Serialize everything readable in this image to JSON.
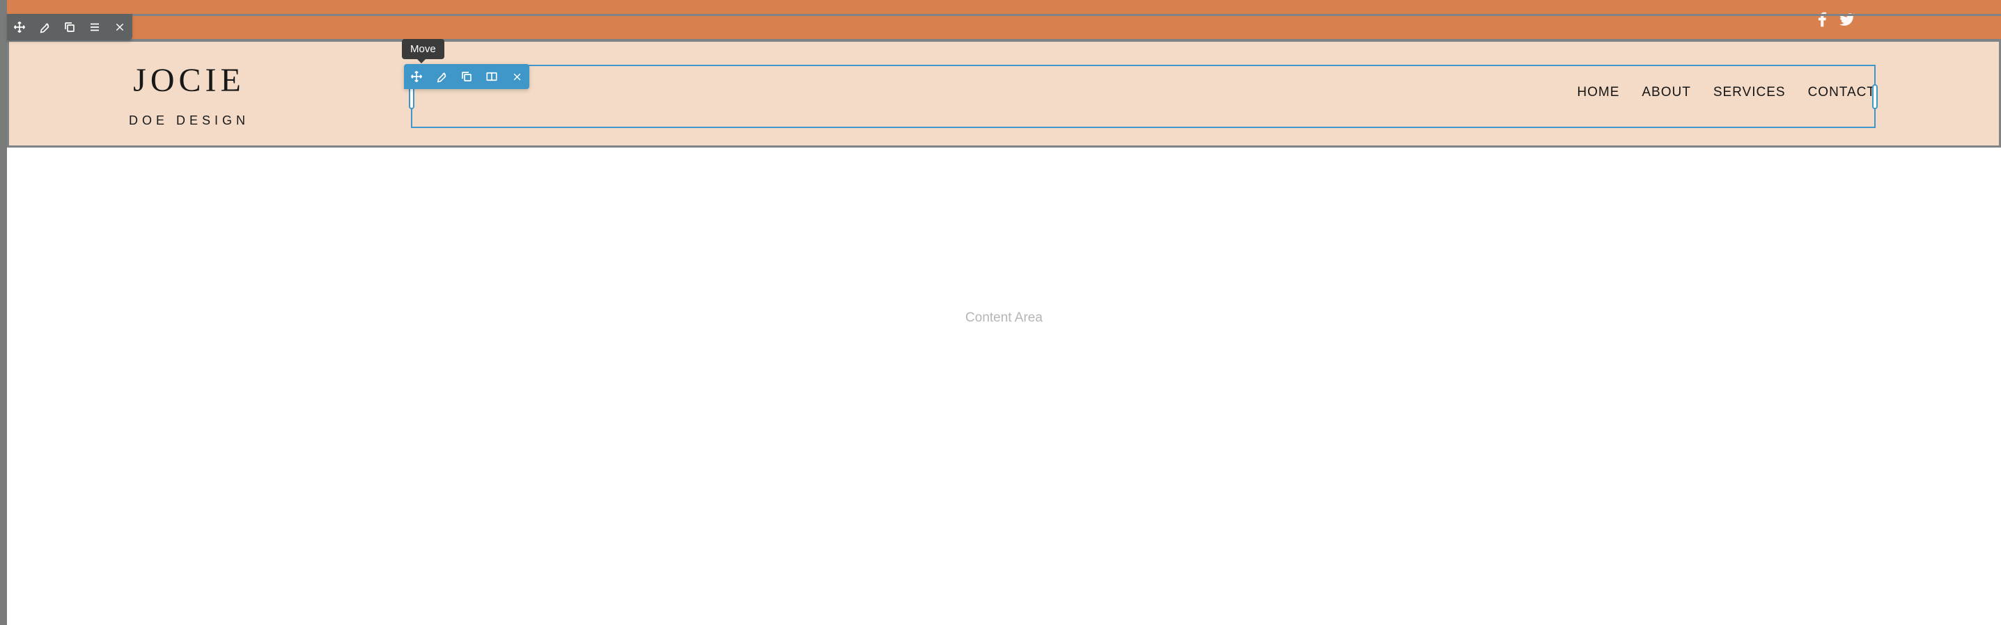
{
  "tooltip": {
    "move": "Move"
  },
  "header": {
    "logo_title": "JOCIE",
    "logo_subtitle": "DOE DESIGN"
  },
  "nav": {
    "items": [
      {
        "label": "HOME"
      },
      {
        "label": "ABOUT"
      },
      {
        "label": "SERVICES"
      },
      {
        "label": "CONTACT"
      }
    ]
  },
  "content": {
    "placeholder": "Content Area"
  }
}
